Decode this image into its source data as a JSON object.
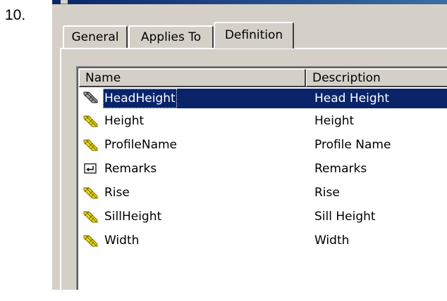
{
  "step_number": "10.",
  "tabs": [
    {
      "label": "General"
    },
    {
      "label": "Applies To"
    },
    {
      "label": "Definition"
    }
  ],
  "list": {
    "columns": [
      "Name",
      "Description"
    ],
    "rows": [
      {
        "name": "HeadHeight",
        "description": "Head Height",
        "icon": "length-property-icon",
        "selected": true
      },
      {
        "name": "Height",
        "description": "Height",
        "icon": "length-property-icon"
      },
      {
        "name": "ProfileName",
        "description": "Profile Name",
        "icon": "length-property-icon"
      },
      {
        "name": "Remarks",
        "description": "Remarks",
        "icon": "text-property-icon"
      },
      {
        "name": "Rise",
        "description": "Rise",
        "icon": "length-property-icon"
      },
      {
        "name": "SillHeight",
        "description": "Sill Height",
        "icon": "length-property-icon"
      },
      {
        "name": "Width",
        "description": "Width",
        "icon": "length-property-icon"
      }
    ]
  },
  "colors": {
    "dialog_face": "#d4d0c8",
    "selection": "#0a246a",
    "length_icon": "#e8e000"
  }
}
